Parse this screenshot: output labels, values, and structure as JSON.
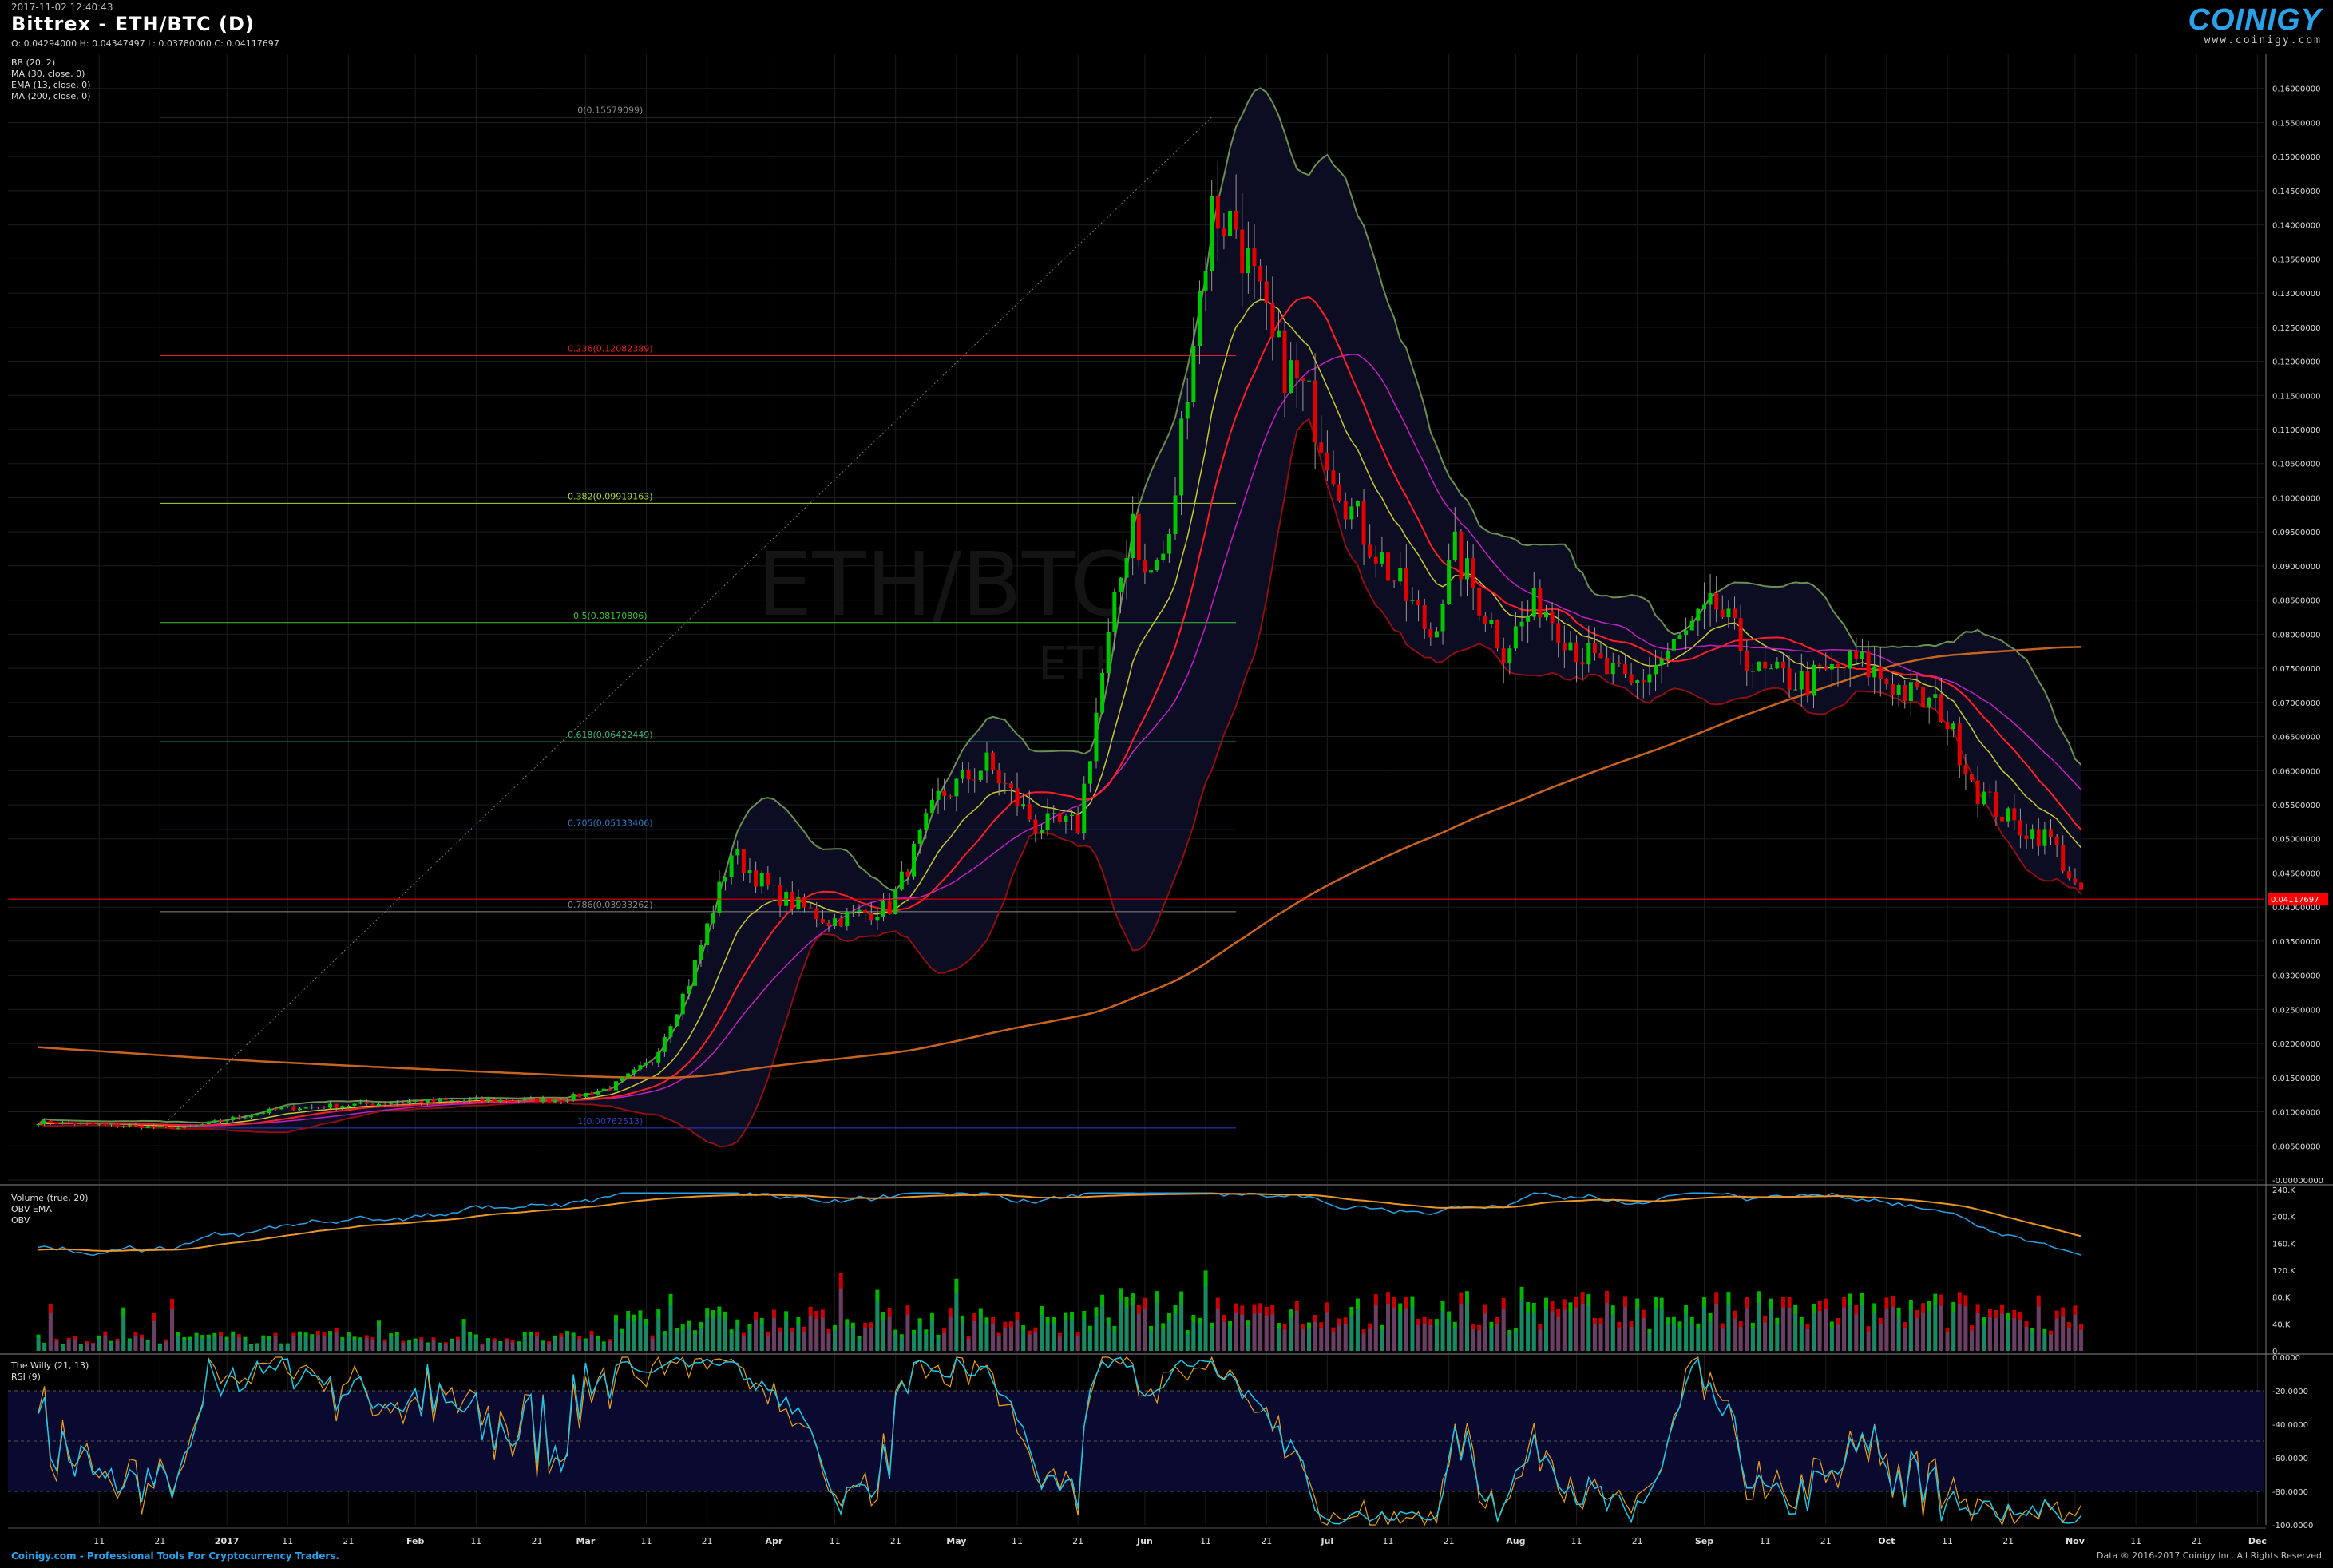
{
  "header": {
    "timestamp": "2017-11-02 12:40:43",
    "title": "Bittrex - ETH/BTC (D)",
    "ohlc": "O: 0.04294000 H: 0.04347497 L: 0.03780000 C: 0.04117697"
  },
  "logo": {
    "name": "COINIGY",
    "url": "www.coinigy.com"
  },
  "watermark": {
    "line1": "ETH/BTC, D",
    "line2": "ETH/BTC"
  },
  "price_panel": {
    "indicators": [
      "BB (20, 2)",
      "MA (30, close, 0)",
      "EMA (13, close, 0)",
      "MA (200, close, 0)"
    ],
    "last_price_label": "0.04117697",
    "last_price_color": "#ff0000"
  },
  "volume_panel": {
    "indicators": [
      "Volume (true, 20)",
      "OBV EMA",
      "OBV"
    ]
  },
  "willy_panel": {
    "indicators": [
      "The Willy (21, 13)",
      "RSI (9)"
    ]
  },
  "footer": {
    "left": "Coinigy.com - Professional Tools For Cryptocurrency Traders.",
    "right": "Data ® 2016-2017 Coinigy Inc. All Rights Reserved"
  },
  "colors": {
    "up": "#00c800",
    "down": "#e00000",
    "bb": "#6b8f4e",
    "ema13": "#c8c830",
    "ma30": "#c020c0",
    "ma200": "#c86420",
    "bbBasis": "#ff1e28",
    "obv": "#2aa1e8",
    "obvEma": "#e8962a",
    "rsi": "#e8a020",
    "willy": "#20c8e8"
  },
  "chart_data": {
    "type": "candlestick",
    "title": "Bittrex - ETH/BTC (D)",
    "x_tick_labels": [
      "11",
      "21",
      "2017",
      "11",
      "21",
      "Feb",
      "11",
      "21",
      "Mar",
      "11",
      "21",
      "Apr",
      "11",
      "21",
      "May",
      "11",
      "21",
      "Jun",
      "11",
      "21",
      "Jul",
      "11",
      "21",
      "Aug",
      "11",
      "21",
      "Sep",
      "11",
      "21",
      "Oct",
      "11",
      "21",
      "Nov",
      "11",
      "21",
      "Dec"
    ],
    "price_axis": {
      "ylim": [
        0.0,
        0.165
      ],
      "tick_labels": [
        "-0.00000000",
        "0.00500000",
        "0.01000000",
        "0.01500000",
        "0.02000000",
        "0.02500000",
        "0.03000000",
        "0.03500000",
        "0.04000000",
        "0.04500000",
        "0.05000000",
        "0.05500000",
        "0.06000000",
        "0.06500000",
        "0.07000000",
        "0.07500000",
        "0.08000000",
        "0.08500000",
        "0.09000000",
        "0.09500000",
        "0.10000000",
        "0.10500000",
        "0.11000000",
        "0.11500000",
        "0.12000000",
        "0.12500000",
        "0.13000000",
        "0.13500000",
        "0.14000000",
        "0.14500000",
        "0.15000000",
        "0.15500000",
        "0.16000000"
      ]
    },
    "close_anchors": [
      [
        "2016-12-01",
        0.0085
      ],
      [
        "2016-12-25",
        0.0076
      ],
      [
        "2017-01-10",
        0.0105
      ],
      [
        "2017-02-01",
        0.0115
      ],
      [
        "2017-02-25",
        0.0118
      ],
      [
        "2017-03-05",
        0.0135
      ],
      [
        "2017-03-12",
        0.0175
      ],
      [
        "2017-03-18",
        0.029
      ],
      [
        "2017-03-25",
        0.048
      ],
      [
        "2017-04-01",
        0.042
      ],
      [
        "2017-04-10",
        0.038
      ],
      [
        "2017-04-20",
        0.04
      ],
      [
        "2017-04-28",
        0.056
      ],
      [
        "2017-05-06",
        0.061
      ],
      [
        "2017-05-14",
        0.052
      ],
      [
        "2017-05-21",
        0.052
      ],
      [
        "2017-05-25",
        0.074
      ],
      [
        "2017-05-30",
        0.098
      ],
      [
        "2017-06-01",
        0.088
      ],
      [
        "2017-06-05",
        0.093
      ],
      [
        "2017-06-08",
        0.118
      ],
      [
        "2017-06-12",
        0.142
      ],
      [
        "2017-06-16",
        0.14
      ],
      [
        "2017-06-22",
        0.122
      ],
      [
        "2017-06-28",
        0.114
      ],
      [
        "2017-07-05",
        0.098
      ],
      [
        "2017-07-12",
        0.088
      ],
      [
        "2017-07-18",
        0.08
      ],
      [
        "2017-07-22",
        0.092
      ],
      [
        "2017-07-30",
        0.078
      ],
      [
        "2017-08-05",
        0.085
      ],
      [
        "2017-08-12",
        0.077
      ],
      [
        "2017-08-20",
        0.072
      ],
      [
        "2017-08-28",
        0.079
      ],
      [
        "2017-09-03",
        0.084
      ],
      [
        "2017-09-10",
        0.074
      ],
      [
        "2017-09-18",
        0.073
      ],
      [
        "2017-09-26",
        0.076
      ],
      [
        "2017-10-05",
        0.071
      ],
      [
        "2017-10-10",
        0.069
      ],
      [
        "2017-10-16",
        0.057
      ],
      [
        "2017-10-22",
        0.052
      ],
      [
        "2017-10-28",
        0.05
      ],
      [
        "2017-11-02",
        0.0412
      ]
    ],
    "fibonacci_levels": [
      {
        "label": "0(0.15579099)",
        "value": 0.15579099,
        "color": "#888888"
      },
      {
        "label": "0.236(0.12082389)",
        "value": 0.12082389,
        "color": "#e02020"
      },
      {
        "label": "0.382(0.09919163)",
        "value": 0.09919163,
        "color": "#a8d840"
      },
      {
        "label": "0.5(0.08170806)",
        "value": 0.08170806,
        "color": "#40c040"
      },
      {
        "label": "0.618(0.06422449)",
        "value": 0.06422449,
        "color": "#40b080"
      },
      {
        "label": "0.705(0.05133406)",
        "value": 0.05133406,
        "color": "#2a7ac8"
      },
      {
        "label": "0.786(0.03933262)",
        "value": 0.03933262,
        "color": "#888888"
      },
      {
        "label": "1(0.00762513)",
        "value": 0.00762513,
        "color": "#3040c0"
      }
    ],
    "last_price": 0.04117697,
    "volume_axis": {
      "tick_labels": [
        "240.K",
        "200.K",
        "160.K",
        "120.K",
        "80.K",
        "40.K",
        "0."
      ],
      "ylim": [
        0,
        240000
      ]
    },
    "willy_axis": {
      "tick_labels": [
        "0.0000",
        "-20.0000",
        "-40.0000",
        "-60.0000",
        "-80.0000",
        "-100.0000"
      ],
      "ylim": [
        -100,
        0
      ]
    }
  }
}
